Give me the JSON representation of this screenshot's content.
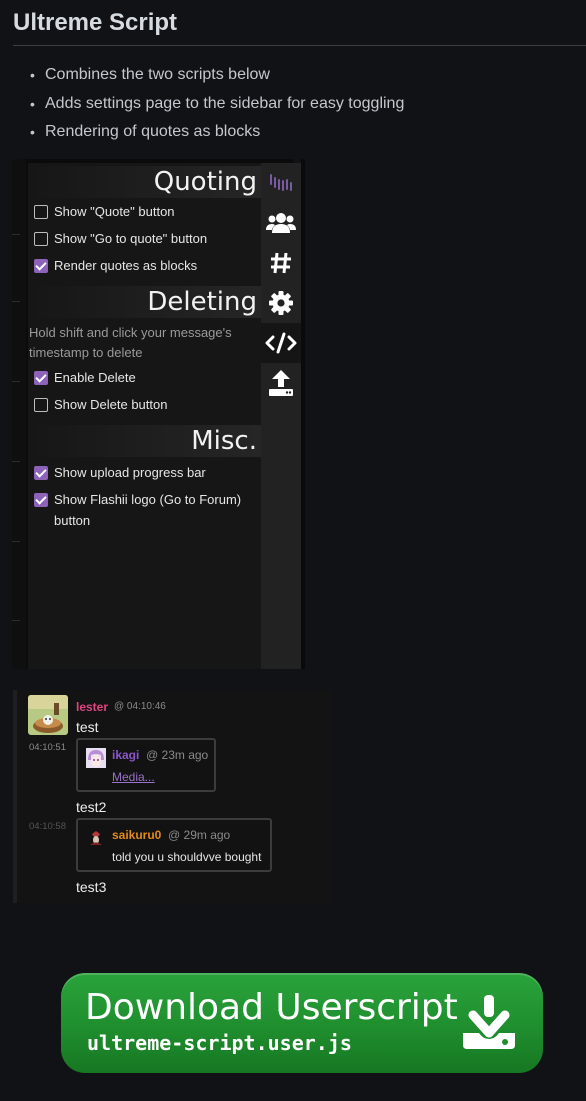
{
  "page": {
    "title": "Ultreme Script"
  },
  "features": [
    "Combines the two scripts below",
    "Adds settings page to the sidebar for easy toggling",
    "Rendering of quotes as blocks"
  ],
  "settings_panel": {
    "sections": {
      "quoting": {
        "title": "Quoting",
        "options": [
          {
            "label": "Show \"Quote\" button",
            "checked": false
          },
          {
            "label": "Show \"Go to quote\" button",
            "checked": false
          },
          {
            "label": "Render quotes as blocks",
            "checked": true
          }
        ]
      },
      "deleting": {
        "title": "Deleting",
        "hint": "Hold shift and click your message's timestamp to delete",
        "options": [
          {
            "label": "Enable Delete",
            "checked": true
          },
          {
            "label": "Show Delete button",
            "checked": false
          }
        ]
      },
      "misc": {
        "title": "Misc.",
        "options": [
          {
            "label": "Show upload progress bar",
            "checked": true
          },
          {
            "label": "Show Flashii logo (Go to Forum) button",
            "checked": true
          }
        ]
      }
    },
    "sidebar_icons": [
      "flashii-logo-icon",
      "users-icon",
      "hashtag-icon",
      "gear-icon",
      "code-icon",
      "upload-icon"
    ],
    "active_sidebar": "code-icon",
    "accent_color": "#8d63b9"
  },
  "chat": {
    "author": {
      "name": "lester",
      "time": "@ 04:10:46",
      "color": "#e0457f"
    },
    "messages": [
      {
        "text": "test",
        "time": ""
      },
      {
        "text": "test2",
        "time": "04:10:51"
      },
      {
        "text": "test3",
        "time": "04:10:58"
      }
    ],
    "quotes": [
      {
        "name": "ikagi",
        "time": "@ 23m ago",
        "body": "Media...",
        "is_link": true,
        "color": "#8a57c9"
      },
      {
        "name": "saikuru0",
        "time": "@ 29m ago",
        "body": "told you u shouldvve bought",
        "is_link": false,
        "color": "#e38a1c"
      }
    ]
  },
  "download": {
    "label": "Download Userscript",
    "filename": "ultreme-script.user.js",
    "color": "#1f8e2e"
  }
}
